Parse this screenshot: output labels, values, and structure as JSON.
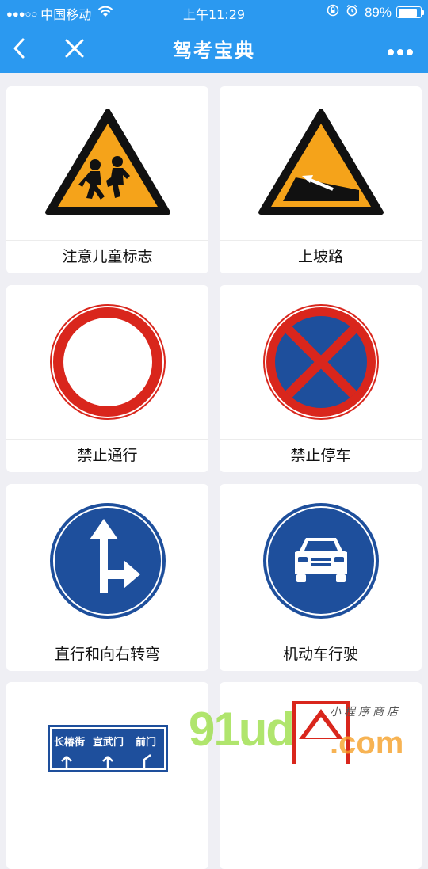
{
  "status_bar": {
    "signal": "●●●○○",
    "carrier": "中国移动",
    "time": "上午11:29",
    "battery": "89%",
    "battery_level": 0.89,
    "icons": [
      "wifi-icon",
      "orientation-lock-icon",
      "alarm-icon",
      "battery-icon"
    ]
  },
  "nav": {
    "title": "驾考宝典",
    "back_icon": "chevron-left-icon",
    "close_icon": "close-icon",
    "more_icon": "more-dots-icon",
    "bar_color": "#2b99f0"
  },
  "signs": [
    {
      "label": "注意儿童标志",
      "icon": "children-warning-sign"
    },
    {
      "label": "上坡路",
      "icon": "uphill-warning-sign"
    },
    {
      "label": "禁止通行",
      "icon": "no-entry-sign"
    },
    {
      "label": "禁止停车",
      "icon": "no-stopping-sign"
    },
    {
      "label": "直行和向右转弯",
      "icon": "straight-or-right-turn-sign"
    },
    {
      "label": "机动车行驶",
      "icon": "motor-vehicles-only-sign"
    },
    {
      "label": "",
      "icon": "direction-guide-sign",
      "sign_texts": [
        "长椿街",
        "宣武门",
        "前门"
      ]
    },
    {
      "label": "",
      "icon": "red-white-warning-sign"
    }
  ],
  "colors": {
    "warning_yellow": "#f5a31a",
    "prohibit_red": "#d9261c",
    "mandatory_blue": "#1e4f9c"
  },
  "watermark": {
    "main": "91ud",
    "suffix": ".com",
    "sub": "小程序商店"
  }
}
